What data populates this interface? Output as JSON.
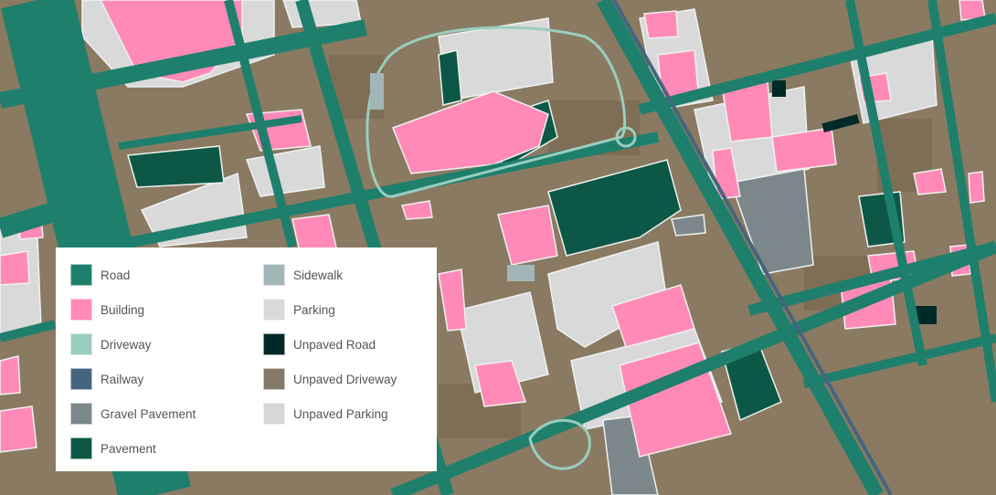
{
  "map": {
    "colors": {
      "ground": "#8a7a62",
      "ground_dark": "#6e6048",
      "road": "#1e7f6c",
      "building": "#ff8ab8",
      "driveway": "#9acdbf",
      "railway": "#45657f",
      "gravel_pavement": "#7b878b",
      "pavement": "#0d5746",
      "sidewalk": "#a2b6b7",
      "parking": "#d9d9d9",
      "unpaved_road": "#002a28",
      "unpaved_driveway": "#84786a",
      "unpaved_parking": "#d7d7d7",
      "outline": "#e8efec"
    }
  },
  "legend": {
    "items": [
      {
        "label": "Road",
        "color": "#1e7f6c"
      },
      {
        "label": "Building",
        "color": "#ff8ab8"
      },
      {
        "label": "Driveway",
        "color": "#9acdbf"
      },
      {
        "label": "Railway",
        "color": "#45657f"
      },
      {
        "label": "Gravel Pavement",
        "color": "#7b878b"
      },
      {
        "label": "Pavement",
        "color": "#0d5746"
      },
      {
        "label": "Sidewalk",
        "color": "#a2b6b7"
      },
      {
        "label": "Parking",
        "color": "#d9d9d9"
      },
      {
        "label": "Unpaved Road",
        "color": "#002a28"
      },
      {
        "label": "Unpaved Driveway",
        "color": "#84786a"
      },
      {
        "label": "Unpaved Parking",
        "color": "#d7d7d7"
      }
    ]
  }
}
